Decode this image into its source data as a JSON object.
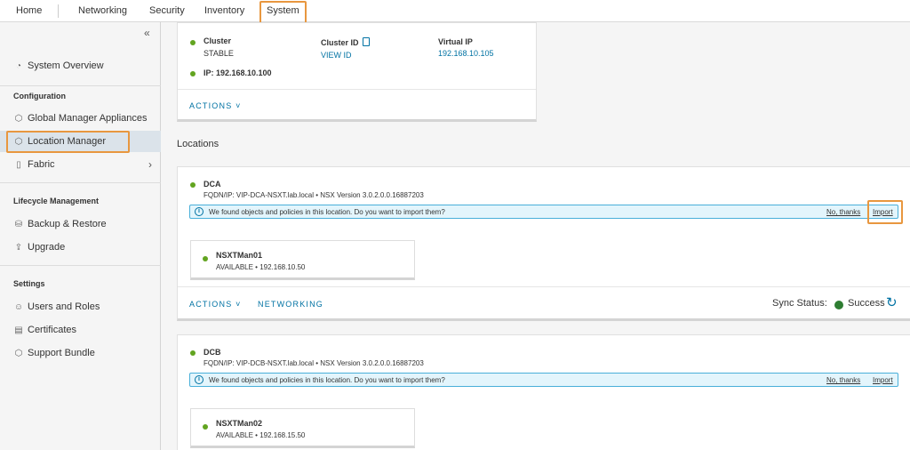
{
  "nav": {
    "tabs": [
      "Home",
      "Networking",
      "Security",
      "Inventory",
      "System"
    ],
    "active": "System"
  },
  "sidebar": {
    "collapse_glyph": "«",
    "system_overview": "System Overview",
    "config_heading": "Configuration",
    "global_manager_appliances": "Global Manager Appliances",
    "location_manager": "Location Manager",
    "fabric": "Fabric",
    "lifecycle_heading": "Lifecycle Management",
    "backup_restore": "Backup & Restore",
    "upgrade": "Upgrade",
    "settings_heading": "Settings",
    "users_roles": "Users and Roles",
    "certificates": "Certificates",
    "support_bundle": "Support Bundle"
  },
  "cluster": {
    "cluster_label": "Cluster",
    "cluster_status": "STABLE",
    "cluster_id_label": "Cluster ID",
    "view_id": "VIEW ID",
    "vip_label": "Virtual IP",
    "vip_value": "192.168.10.105",
    "ip": "IP: 192.168.10.100",
    "actions": "ACTIONS"
  },
  "locations_heading": "Locations",
  "locations": [
    {
      "name": "DCA",
      "fqdn": "FQDN/IP: VIP-DCA-NSXT.lab.local • NSX Version 3.0.2.0.0.16887203",
      "alert": "We found objects and policies in this location. Do you want to import them?",
      "no_thanks": "No, thanks",
      "import": "Import",
      "node_name": "NSXTMan01",
      "node_status": "AVAILABLE • 192.168.10.50",
      "actions": "ACTIONS",
      "networking": "NETWORKING",
      "sync_label": "Sync Status:",
      "sync_value": "Success"
    },
    {
      "name": "DCB",
      "fqdn": "FQDN/IP: VIP-DCB-NSXT.lab.local • NSX Version 3.0.2.0.0.16887203",
      "alert": "We found objects and policies in this location. Do you want to import them?",
      "no_thanks": "No, thanks",
      "import": "Import",
      "node_name": "NSXTMan02",
      "node_status": "AVAILABLE • 192.168.15.50"
    }
  ],
  "colors": {
    "accent": "#0072a3",
    "highlight": "#e8973f",
    "status_green": "#62a420"
  }
}
